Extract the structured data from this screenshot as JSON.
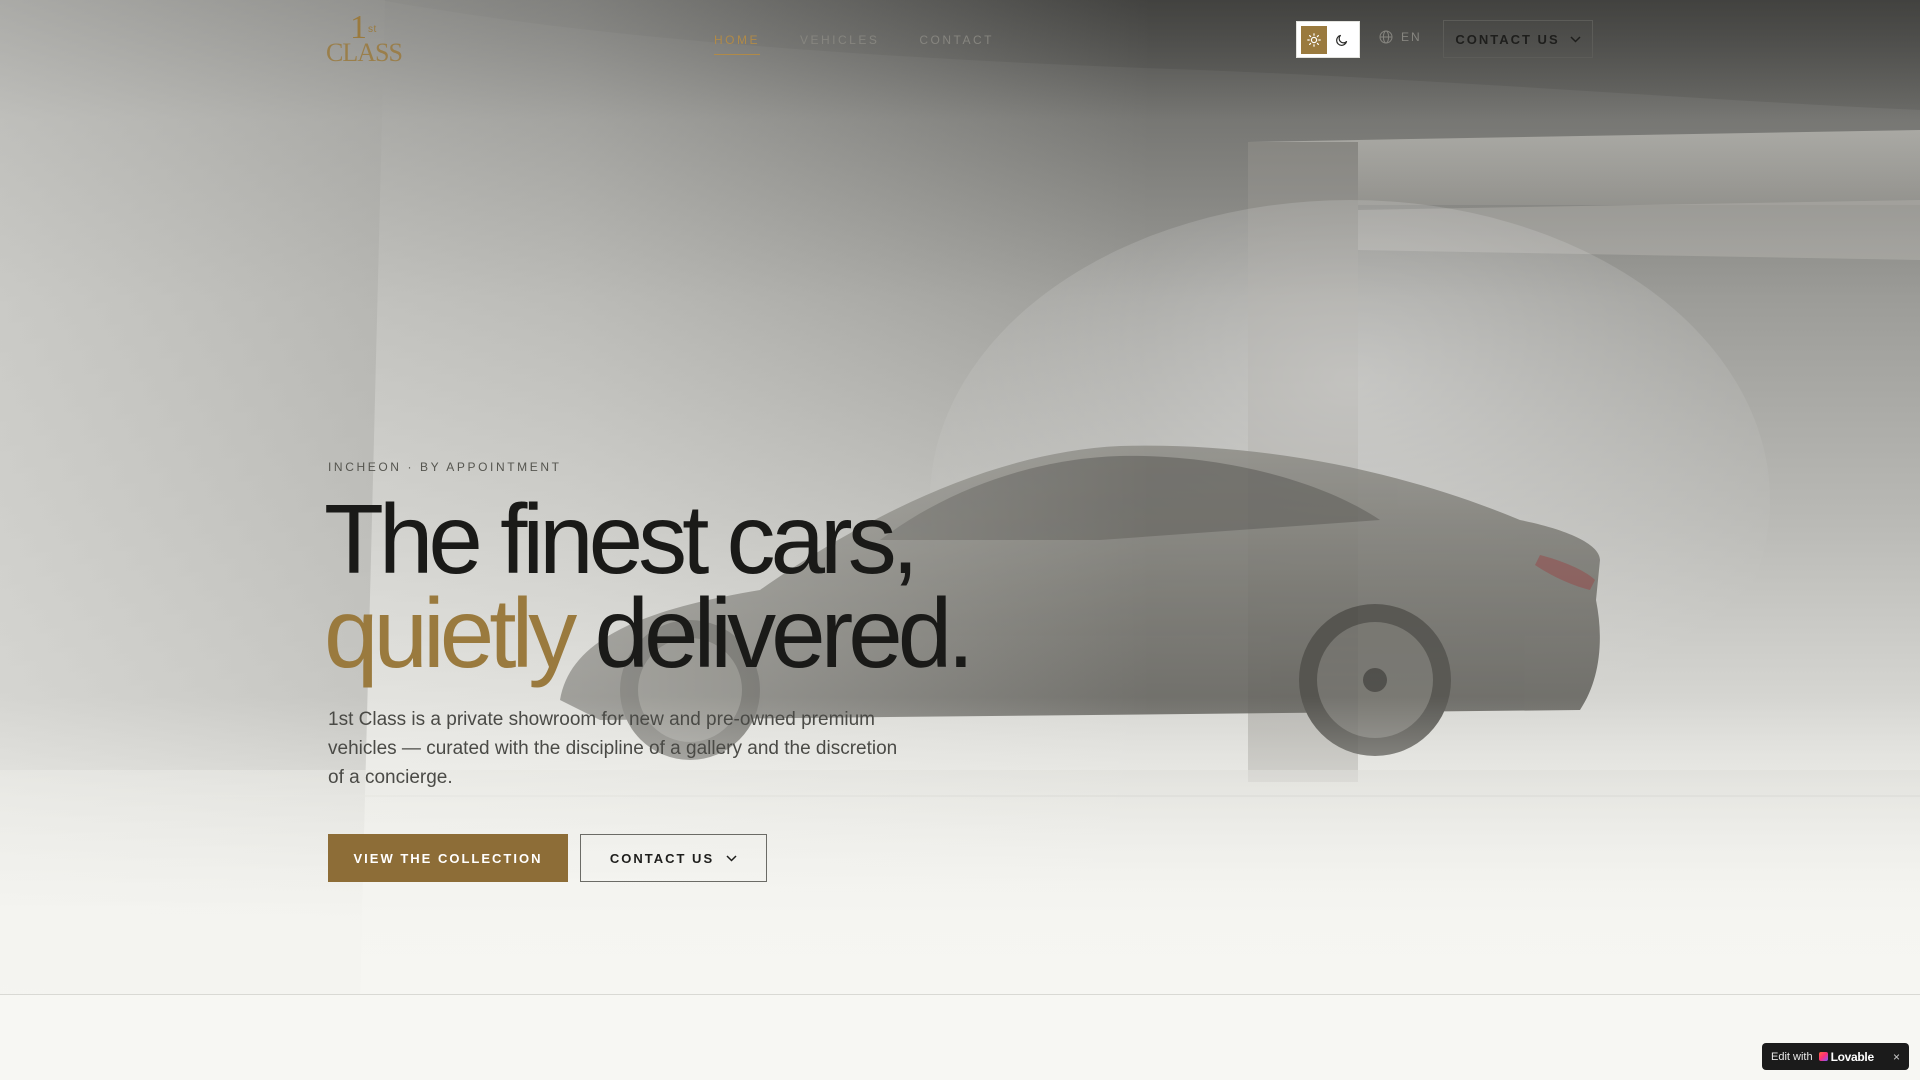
{
  "brand": {
    "logo_number": "1",
    "logo_suffix": "st",
    "logo_word": "CLASS"
  },
  "nav": {
    "items": [
      {
        "label": "HOME",
        "active": true
      },
      {
        "label": "VEHICLES",
        "active": false
      },
      {
        "label": "CONTACT",
        "active": false
      }
    ]
  },
  "header": {
    "theme_light_icon": "sun-icon",
    "theme_dark_icon": "moon-icon",
    "theme_active": "light",
    "language_icon": "globe-icon",
    "language": "EN",
    "contact_label": "CONTACT US",
    "contact_icon": "chevron-down-icon"
  },
  "hero": {
    "eyebrow": "INCHEON · BY APPOINTMENT",
    "headline_line1": "The finest cars,",
    "headline_accent": "quietly",
    "headline_rest": "delivered.",
    "lede": "1st Class is a private showroom for new and pre-owned premium vehicles — curated with the discipline of a gallery and the discretion of a concierge.",
    "primary_cta": "VIEW THE COLLECTION",
    "secondary_cta": "CONTACT US",
    "secondary_cta_icon": "chevron-down-icon"
  },
  "badge": {
    "prefix": "Edit with",
    "brand": "Lovable",
    "close": "×"
  },
  "colors": {
    "accent": "#9a7a3e",
    "primary_button": "#8d6d37",
    "text_dark": "#1a1a18"
  }
}
